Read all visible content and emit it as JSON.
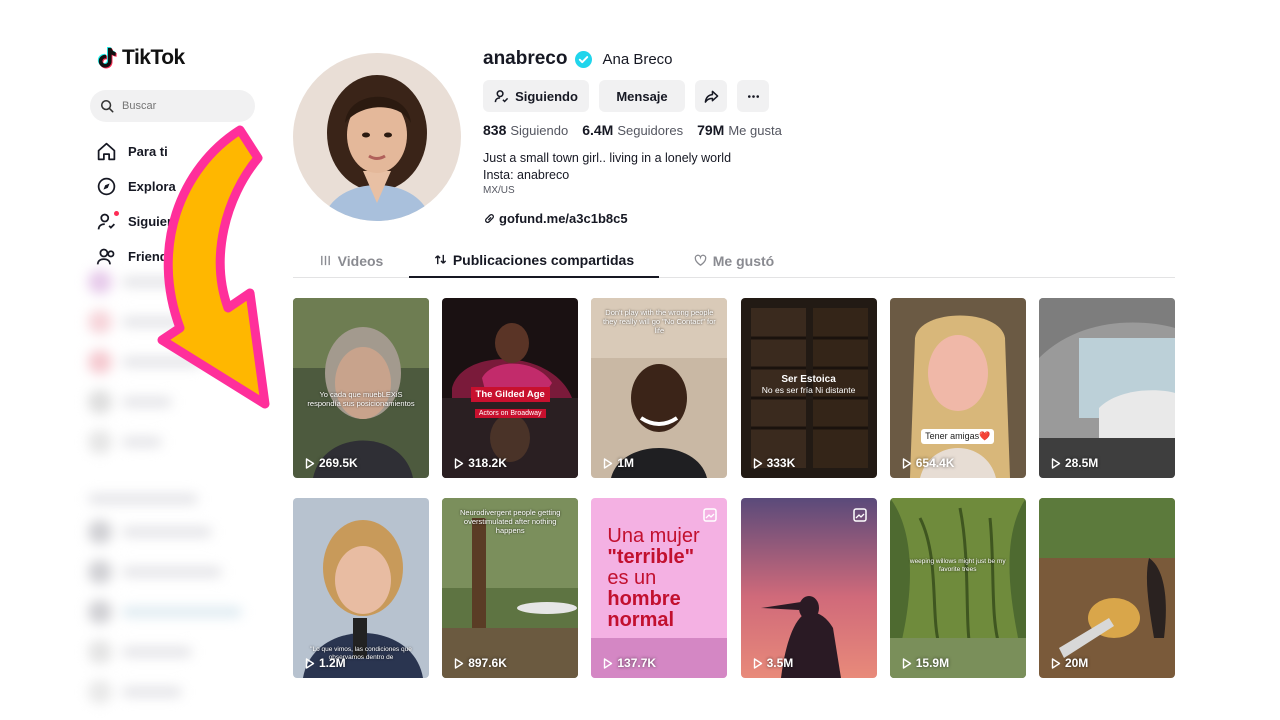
{
  "sidebar": {
    "logo": "TikTok",
    "search_placeholder": "Buscar",
    "items": [
      {
        "label": "Para ti"
      },
      {
        "label": "Explora"
      },
      {
        "label": "Siguiendo"
      },
      {
        "label": "Friends"
      }
    ]
  },
  "profile": {
    "username": "anabreco",
    "nickname": "Ana Breco",
    "verified": true,
    "buttons": {
      "following": "Siguiendo",
      "message": "Mensaje"
    },
    "stats": [
      {
        "value": "838",
        "label": "Siguiendo"
      },
      {
        "value": "6.4M",
        "label": "Seguidores"
      },
      {
        "value": "79M",
        "label": "Me gusta"
      }
    ],
    "bio": [
      "Just a small town girl.. living in a lonely world",
      "Insta: anabreco"
    ],
    "region": "MX/US",
    "link": "gofund.me/a3c1b8c5"
  },
  "tabs": [
    {
      "label": "Videos",
      "active": false
    },
    {
      "label": "Publicaciones compartidas",
      "active": true
    },
    {
      "label": "Me gustó",
      "active": false
    }
  ],
  "videos": [
    {
      "views": "269.5K",
      "caption": "Yo cada que muebLEXiS respondía sus posicionamientos"
    },
    {
      "views": "318.2K",
      "caption": "The Gilded Age",
      "subcaption": "Actors on Broadway"
    },
    {
      "views": "1M",
      "caption": "Don't play with the wrong people they really will go \"No Contact\" for life"
    },
    {
      "views": "333K",
      "caption": "Ser Estoica",
      "subcaption": "No es ser fría Ni distante"
    },
    {
      "views": "654.4K",
      "caption": "Tener amigas❤️"
    },
    {
      "views": "28.5M"
    },
    {
      "views": "1.2M",
      "caption": "\"Lo que vimos, las condiciones que observamos dentro de"
    },
    {
      "views": "897.6K",
      "caption": "Neurodivergent people getting overstimulated after nothing happens"
    },
    {
      "views": "137.7K",
      "big_text": [
        "Una mujer",
        "\"terrible\"",
        "es un",
        "hombre",
        "normal"
      ],
      "multi": true
    },
    {
      "views": "3.5M",
      "multi": true
    },
    {
      "views": "15.9M",
      "caption": "weeping willows might just be my favorite trees"
    },
    {
      "views": "20M"
    }
  ],
  "colors": {
    "accent": "#fe2c55",
    "verified": "#20d5ec",
    "arrow_fill": "#ffb700",
    "arrow_stroke": "#ff2f9b"
  }
}
